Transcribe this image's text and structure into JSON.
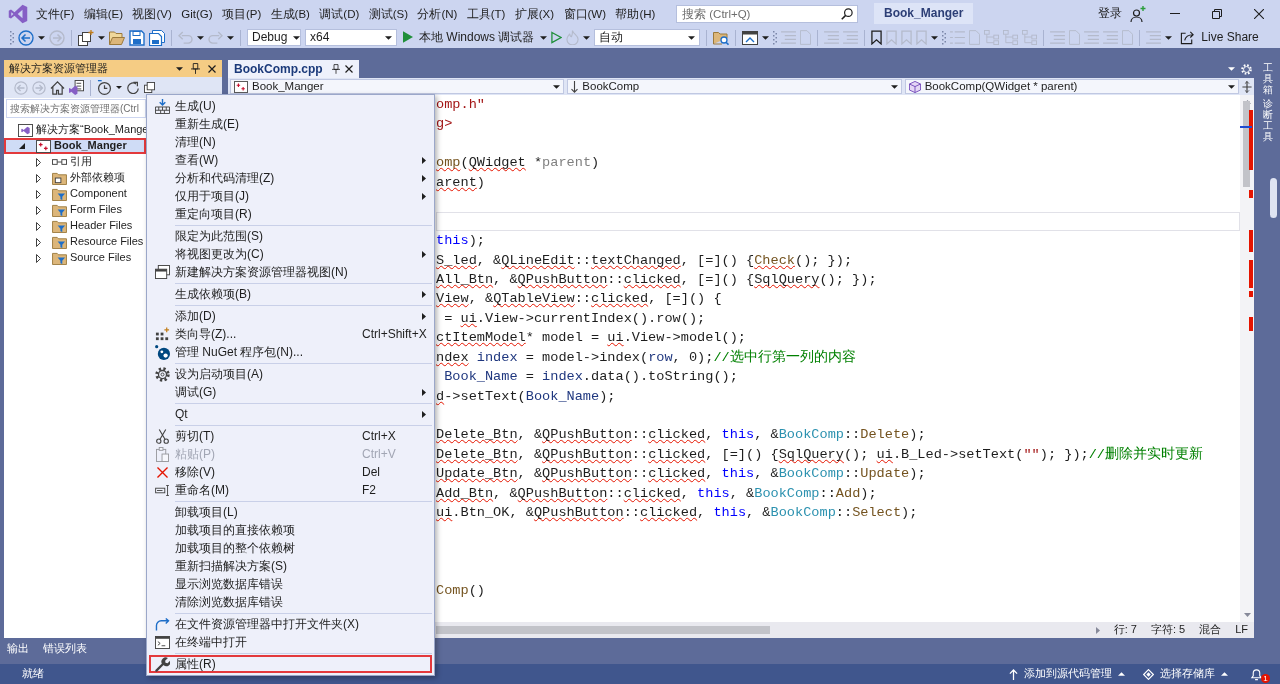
{
  "title_bar": {
    "menus": [
      "文件(F)",
      "编辑(E)",
      "视图(V)",
      "Git(G)",
      "项目(P)",
      "生成(B)",
      "调试(D)",
      "测试(S)",
      "分析(N)",
      "工具(T)",
      "扩展(X)",
      "窗口(W)",
      "帮助(H)"
    ],
    "search": {
      "placeholder": "搜索 (Ctrl+Q)"
    },
    "solution_name": "Book_Manger",
    "sign_in": "登录"
  },
  "toolbar": {
    "configuration": "Debug",
    "platform": "x64",
    "debugger": "本地 Windows 调试器",
    "stack_frame": "自动",
    "live_share": "Live Share"
  },
  "solution_explorer": {
    "title": "解决方案资源管理器",
    "search": {
      "placeholder": "搜索解决方案资源管理器(Ctrl"
    },
    "tree": [
      {
        "label": "解决方案“Book_Mange",
        "kind": "solution",
        "selected": false,
        "highlighted": false,
        "children": [
          {
            "label": "Book_Manger",
            "kind": "project",
            "expanded": true,
            "selected": true,
            "highlighted": true,
            "children": [
              {
                "label": "引用",
                "kind": "references",
                "expanded": false,
                "selected": false,
                "highlighted": false
              },
              {
                "label": "外部依赖项",
                "kind": "external",
                "expanded": false,
                "selected": false,
                "highlighted": false
              },
              {
                "label": "Component",
                "kind": "filter",
                "expanded": false,
                "selected": false,
                "highlighted": false
              },
              {
                "label": "Form Files",
                "kind": "filter",
                "expanded": false,
                "selected": false,
                "highlighted": false
              },
              {
                "label": "Header Files",
                "kind": "filter",
                "expanded": false,
                "selected": false,
                "highlighted": false
              },
              {
                "label": "Resource Files",
                "kind": "filter",
                "expanded": false,
                "selected": false,
                "highlighted": false
              },
              {
                "label": "Source Files",
                "kind": "filter",
                "expanded": false,
                "selected": false,
                "highlighted": false
              }
            ]
          }
        ]
      }
    ]
  },
  "bottom_tabs": [
    {
      "label": "输出",
      "selected": false
    },
    {
      "label": "错误列表",
      "selected": false
    }
  ],
  "editor": {
    "tabs": [
      {
        "title": "BookComp.cpp",
        "selected": true
      }
    ],
    "nav": [
      "Book_Manger",
      "BookComp",
      "BookComp(QWidget * parent)"
    ],
    "lines": [
      {
        "current": false,
        "tokens": [
          {
            "text": "omp.h\"",
            "kind": "string",
            "squiggle": false
          }
        ]
      },
      {
        "current": false,
        "tokens": [
          {
            "text": "g>",
            "kind": "string",
            "squiggle": false
          }
        ]
      },
      {
        "current": false
      },
      {
        "current": false,
        "tokens": [
          {
            "text": "omp",
            "kind": "function",
            "squiggle": true
          },
          {
            "text": "(",
            "kind": "plain",
            "squiggle": false
          },
          {
            "text": "QWidget",
            "kind": "plain",
            "squiggle": true
          },
          {
            "text": " *",
            "kind": "plain",
            "squiggle": false
          },
          {
            "text": "parent",
            "kind": "param",
            "squiggle": false
          },
          {
            "text": ")",
            "kind": "plain",
            "squiggle": false
          }
        ]
      },
      {
        "current": false,
        "tokens": [
          {
            "text": "arent",
            "kind": "plain",
            "squiggle": true
          },
          {
            "text": ")",
            "kind": "plain",
            "squiggle": false
          }
        ]
      },
      {
        "current": false
      },
      {
        "current": true
      },
      {
        "current": false,
        "tokens": [
          {
            "text": "this",
            "kind": "keyword",
            "squiggle": false
          },
          {
            "text": ");",
            "kind": "plain",
            "squiggle": false
          }
        ]
      },
      {
        "current": false,
        "tokens": [
          {
            "text": "S_led",
            "kind": "plain",
            "squiggle": true
          },
          {
            "text": ", &",
            "kind": "plain",
            "squiggle": false
          },
          {
            "text": "QLineEdit",
            "kind": "plain",
            "squiggle": true
          },
          {
            "text": "::",
            "kind": "plain",
            "squiggle": false
          },
          {
            "text": "textChanged",
            "kind": "plain",
            "squiggle": true
          },
          {
            "text": ", [=]() {",
            "kind": "plain",
            "squiggle": false
          },
          {
            "text": "Check",
            "kind": "function",
            "squiggle": true
          },
          {
            "text": "(); });",
            "kind": "plain",
            "squiggle": false
          }
        ]
      },
      {
        "current": false,
        "tokens": [
          {
            "text": "All_Btn",
            "kind": "plain",
            "squiggle": true
          },
          {
            "text": ", &",
            "kind": "plain",
            "squiggle": false
          },
          {
            "text": "QPushButton",
            "kind": "plain",
            "squiggle": true
          },
          {
            "text": "::",
            "kind": "plain",
            "squiggle": false
          },
          {
            "text": "clicked",
            "kind": "plain",
            "squiggle": true
          },
          {
            "text": ", [=]() {",
            "kind": "plain",
            "squiggle": false
          },
          {
            "text": "SqlQuery",
            "kind": "plain",
            "squiggle": true
          },
          {
            "text": "(); });",
            "kind": "plain",
            "squiggle": false
          }
        ]
      },
      {
        "current": false,
        "tokens": [
          {
            "text": "View",
            "kind": "plain",
            "squiggle": true
          },
          {
            "text": ", &",
            "kind": "plain",
            "squiggle": false
          },
          {
            "text": "QTableView",
            "kind": "plain",
            "squiggle": true
          },
          {
            "text": "::",
            "kind": "plain",
            "squiggle": false
          },
          {
            "text": "clicked",
            "kind": "plain",
            "squiggle": true
          },
          {
            "text": ", [=]() {",
            "kind": "plain",
            "squiggle": false
          }
        ]
      },
      {
        "current": false,
        "tokens": [
          {
            "text": " = ",
            "kind": "plain",
            "squiggle": false
          },
          {
            "text": "ui",
            "kind": "plain",
            "squiggle": true
          },
          {
            "text": ".View->currentIndex().row();",
            "kind": "plain",
            "squiggle": false
          }
        ]
      },
      {
        "current": false,
        "tokens": [
          {
            "text": "ctItemModel",
            "kind": "plain",
            "squiggle": true
          },
          {
            "text": "* model = ",
            "kind": "plain",
            "squiggle": false
          },
          {
            "text": "ui",
            "kind": "plain",
            "squiggle": true
          },
          {
            "text": ".View->model();",
            "kind": "plain",
            "squiggle": false
          }
        ]
      },
      {
        "current": false,
        "tokens": [
          {
            "text": "ndex",
            "kind": "plain",
            "squiggle": true
          },
          {
            "text": " index",
            "kind": "local",
            "squiggle": false
          },
          {
            "text": " = model->index(",
            "kind": "plain",
            "squiggle": false
          },
          {
            "text": "row",
            "kind": "local",
            "squiggle": false
          },
          {
            "text": ", 0);",
            "kind": "plain",
            "squiggle": false
          },
          {
            "text": "//选中行第一列的内容",
            "kind": "comment",
            "squiggle": false
          }
        ]
      },
      {
        "current": false,
        "tokens": [
          {
            "text": " Book_Name",
            "kind": "local",
            "squiggle": false
          },
          {
            "text": " = ",
            "kind": "plain",
            "squiggle": false
          },
          {
            "text": "index",
            "kind": "local",
            "squiggle": false
          },
          {
            "text": ".data().toString();",
            "kind": "plain",
            "squiggle": false
          }
        ]
      },
      {
        "current": false,
        "tokens": [
          {
            "text": "d",
            "kind": "plain",
            "squiggle": true
          },
          {
            "text": "->setText(",
            "kind": "plain",
            "squiggle": false
          },
          {
            "text": "Book_Name",
            "kind": "local",
            "squiggle": false
          },
          {
            "text": ");",
            "kind": "plain",
            "squiggle": false
          }
        ]
      },
      {
        "current": false
      },
      {
        "current": false,
        "tokens": [
          {
            "text": "Delete_Btn",
            "kind": "plain",
            "squiggle": true
          },
          {
            "text": ", &",
            "kind": "plain",
            "squiggle": false
          },
          {
            "text": "QPushButton",
            "kind": "plain",
            "squiggle": true
          },
          {
            "text": "::",
            "kind": "plain",
            "squiggle": false
          },
          {
            "text": "clicked",
            "kind": "plain",
            "squiggle": true
          },
          {
            "text": ", ",
            "kind": "plain",
            "squiggle": false
          },
          {
            "text": "this",
            "kind": "keyword",
            "squiggle": false
          },
          {
            "text": ", &",
            "kind": "plain",
            "squiggle": false
          },
          {
            "text": "BookComp",
            "kind": "type",
            "squiggle": false
          },
          {
            "text": "::",
            "kind": "plain",
            "squiggle": false
          },
          {
            "text": "Delete",
            "kind": "function",
            "squiggle": false
          },
          {
            "text": ");",
            "kind": "plain",
            "squiggle": false
          }
        ]
      },
      {
        "current": false,
        "tokens": [
          {
            "text": "Delete_Btn",
            "kind": "plain",
            "squiggle": true
          },
          {
            "text": ", &",
            "kind": "plain",
            "squiggle": false
          },
          {
            "text": "QPushButton",
            "kind": "plain",
            "squiggle": true
          },
          {
            "text": "::",
            "kind": "plain",
            "squiggle": false
          },
          {
            "text": "clicked",
            "kind": "plain",
            "squiggle": true
          },
          {
            "text": ", [=]() {",
            "kind": "plain",
            "squiggle": false
          },
          {
            "text": "SqlQuery",
            "kind": "plain",
            "squiggle": true
          },
          {
            "text": "(); ",
            "kind": "plain",
            "squiggle": false
          },
          {
            "text": "ui",
            "kind": "plain",
            "squiggle": true
          },
          {
            "text": ".B_Led->setText(",
            "kind": "plain",
            "squiggle": false
          },
          {
            "text": "\"\"",
            "kind": "string",
            "squiggle": false
          },
          {
            "text": "); });",
            "kind": "plain",
            "squiggle": false
          },
          {
            "text": "//删除并实时更新",
            "kind": "comment",
            "squiggle": false
          }
        ]
      },
      {
        "current": false,
        "tokens": [
          {
            "text": "Update_Btn",
            "kind": "plain",
            "squiggle": true
          },
          {
            "text": ", &",
            "kind": "plain",
            "squiggle": false
          },
          {
            "text": "QPushButton",
            "kind": "plain",
            "squiggle": true
          },
          {
            "text": "::",
            "kind": "plain",
            "squiggle": false
          },
          {
            "text": "clicked",
            "kind": "plain",
            "squiggle": true
          },
          {
            "text": ", ",
            "kind": "plain",
            "squiggle": false
          },
          {
            "text": "this",
            "kind": "keyword",
            "squiggle": false
          },
          {
            "text": ", &",
            "kind": "plain",
            "squiggle": false
          },
          {
            "text": "BookComp",
            "kind": "type",
            "squiggle": false
          },
          {
            "text": "::",
            "kind": "plain",
            "squiggle": false
          },
          {
            "text": "Update",
            "kind": "function",
            "squiggle": false
          },
          {
            "text": ");",
            "kind": "plain",
            "squiggle": false
          }
        ]
      },
      {
        "current": false,
        "tokens": [
          {
            "text": "Add_Btn",
            "kind": "plain",
            "squiggle": true
          },
          {
            "text": ", &",
            "kind": "plain",
            "squiggle": false
          },
          {
            "text": "QPushButton",
            "kind": "plain",
            "squiggle": true
          },
          {
            "text": "::",
            "kind": "plain",
            "squiggle": false
          },
          {
            "text": "clicked",
            "kind": "plain",
            "squiggle": true
          },
          {
            "text": ", ",
            "kind": "plain",
            "squiggle": false
          },
          {
            "text": "this",
            "kind": "keyword",
            "squiggle": false
          },
          {
            "text": ", &",
            "kind": "plain",
            "squiggle": false
          },
          {
            "text": "BookComp",
            "kind": "type",
            "squiggle": false
          },
          {
            "text": "::",
            "kind": "plain",
            "squiggle": false
          },
          {
            "text": "Add",
            "kind": "function",
            "squiggle": false
          },
          {
            "text": ");",
            "kind": "plain",
            "squiggle": false
          }
        ]
      },
      {
        "current": false,
        "tokens": [
          {
            "text": "ui",
            "kind": "plain",
            "squiggle": true
          },
          {
            "text": ".Btn_OK, &",
            "kind": "plain",
            "squiggle": false
          },
          {
            "text": "QPushButton",
            "kind": "plain",
            "squiggle": true
          },
          {
            "text": "::",
            "kind": "plain",
            "squiggle": false
          },
          {
            "text": "clicked",
            "kind": "plain",
            "squiggle": true
          },
          {
            "text": ", ",
            "kind": "plain",
            "squiggle": false
          },
          {
            "text": "this",
            "kind": "keyword",
            "squiggle": false
          },
          {
            "text": ", &",
            "kind": "plain",
            "squiggle": false
          },
          {
            "text": "BookComp",
            "kind": "type",
            "squiggle": false
          },
          {
            "text": "::",
            "kind": "plain",
            "squiggle": false
          },
          {
            "text": "Select",
            "kind": "function",
            "squiggle": false
          },
          {
            "text": ");",
            "kind": "plain",
            "squiggle": false
          }
        ]
      },
      {
        "current": false
      },
      {
        "current": false
      },
      {
        "current": false
      },
      {
        "current": false,
        "tokens": [
          {
            "text": "Comp",
            "kind": "function",
            "squiggle": false
          },
          {
            "text": "()",
            "kind": "plain",
            "squiggle": false
          }
        ]
      }
    ],
    "status": {
      "line": "行: 7",
      "column": "字符: 5",
      "whitespace": "混合",
      "line_ending": "LF"
    }
  },
  "side_tabs": [
    "工具箱",
    "诊断工具"
  ],
  "context_menu": {
    "groups": [
      [
        {
          "label": "生成(U)",
          "submenu": false,
          "disabled": false,
          "highlighted": false
        },
        {
          "label": "重新生成(E)",
          "submenu": false,
          "disabled": false,
          "highlighted": false
        },
        {
          "label": "清理(N)",
          "submenu": false,
          "disabled": false,
          "highlighted": false
        },
        {
          "label": "查看(W)",
          "submenu": true,
          "disabled": false,
          "highlighted": false
        },
        {
          "label": "分析和代码清理(Z)",
          "submenu": true,
          "disabled": false,
          "highlighted": false
        },
        {
          "label": "仅用于项目(J)",
          "submenu": true,
          "disabled": false,
          "highlighted": false
        },
        {
          "label": "重定向项目(R)",
          "submenu": false,
          "disabled": false,
          "highlighted": false
        }
      ],
      [
        {
          "label": "限定为此范围(S)",
          "submenu": false,
          "disabled": false,
          "highlighted": false
        },
        {
          "label": "将视图更改为(C)",
          "submenu": true,
          "disabled": false,
          "highlighted": false
        },
        {
          "label": "新建解决方案资源管理器视图(N)",
          "submenu": false,
          "disabled": false,
          "highlighted": false
        }
      ],
      [
        {
          "label": "生成依赖项(B)",
          "submenu": true,
          "disabled": false,
          "highlighted": false
        }
      ],
      [
        {
          "label": "添加(D)",
          "submenu": true,
          "disabled": false,
          "highlighted": false
        },
        {
          "label": "类向导(Z)...",
          "shortcut": "Ctrl+Shift+X",
          "submenu": false,
          "disabled": false,
          "highlighted": false
        },
        {
          "label": "管理 NuGet 程序包(N)...",
          "submenu": false,
          "disabled": false,
          "highlighted": false
        }
      ],
      [
        {
          "label": "设为启动项目(A)",
          "submenu": false,
          "disabled": false,
          "highlighted": false
        },
        {
          "label": "调试(G)",
          "submenu": true,
          "disabled": false,
          "highlighted": false
        }
      ],
      [
        {
          "label": "Qt",
          "submenu": true,
          "disabled": false,
          "highlighted": false
        }
      ],
      [
        {
          "label": "剪切(T)",
          "shortcut": "Ctrl+X",
          "submenu": false,
          "disabled": false,
          "highlighted": false
        },
        {
          "label": "粘贴(P)",
          "shortcut": "Ctrl+V",
          "submenu": false,
          "disabled": true,
          "highlighted": false
        },
        {
          "label": "移除(V)",
          "shortcut": "Del",
          "submenu": false,
          "disabled": false,
          "highlighted": false
        },
        {
          "label": "重命名(M)",
          "shortcut": "F2",
          "submenu": false,
          "disabled": false,
          "highlighted": false
        }
      ],
      [
        {
          "label": "卸载项目(L)",
          "submenu": false,
          "disabled": false,
          "highlighted": false
        },
        {
          "label": "加载项目的直接依赖项",
          "submenu": false,
          "disabled": false,
          "highlighted": false
        },
        {
          "label": "加载项目的整个依赖树",
          "submenu": false,
          "disabled": false,
          "highlighted": false
        },
        {
          "label": "重新扫描解决方案(S)",
          "submenu": false,
          "disabled": false,
          "highlighted": false
        },
        {
          "label": "显示浏览数据库错误",
          "submenu": false,
          "disabled": false,
          "highlighted": false
        },
        {
          "label": "清除浏览数据库错误",
          "submenu": false,
          "disabled": false,
          "highlighted": false
        }
      ],
      [
        {
          "label": "在文件资源管理器中打开文件夹(X)",
          "submenu": false,
          "disabled": false,
          "highlighted": false
        },
        {
          "label": "在终端中打开",
          "submenu": false,
          "disabled": false,
          "highlighted": false
        }
      ],
      [
        {
          "label": "属性(R)",
          "submenu": false,
          "disabled": false,
          "highlighted": true
        }
      ]
    ]
  },
  "status_bar": {
    "text": "就绪",
    "source_control": "添加到源代码管理",
    "repository": "选择存储库",
    "notifications": "1"
  }
}
